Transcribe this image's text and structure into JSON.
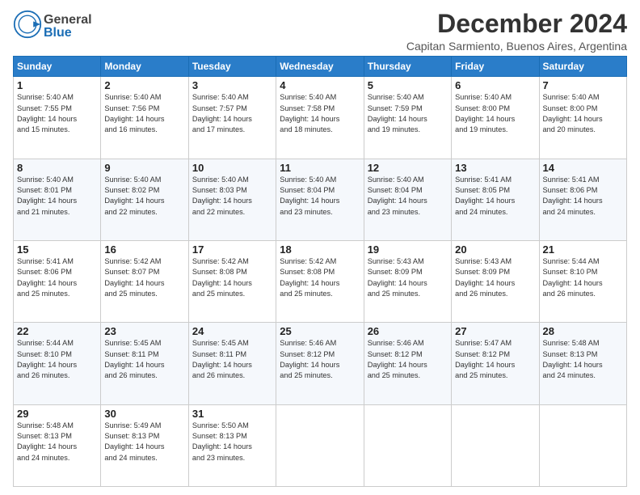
{
  "header": {
    "title": "December 2024",
    "subtitle": "Capitan Sarmiento, Buenos Aires, Argentina",
    "logo_general": "General",
    "logo_blue": "Blue"
  },
  "days_of_week": [
    "Sunday",
    "Monday",
    "Tuesday",
    "Wednesday",
    "Thursday",
    "Friday",
    "Saturday"
  ],
  "weeks": [
    [
      {
        "num": "1",
        "sunrise": "5:40 AM",
        "sunset": "7:55 PM",
        "daylight": "14 hours and 15 minutes."
      },
      {
        "num": "2",
        "sunrise": "5:40 AM",
        "sunset": "7:56 PM",
        "daylight": "14 hours and 16 minutes."
      },
      {
        "num": "3",
        "sunrise": "5:40 AM",
        "sunset": "7:57 PM",
        "daylight": "14 hours and 17 minutes."
      },
      {
        "num": "4",
        "sunrise": "5:40 AM",
        "sunset": "7:58 PM",
        "daylight": "14 hours and 18 minutes."
      },
      {
        "num": "5",
        "sunrise": "5:40 AM",
        "sunset": "7:59 PM",
        "daylight": "14 hours and 19 minutes."
      },
      {
        "num": "6",
        "sunrise": "5:40 AM",
        "sunset": "8:00 PM",
        "daylight": "14 hours and 19 minutes."
      },
      {
        "num": "7",
        "sunrise": "5:40 AM",
        "sunset": "8:00 PM",
        "daylight": "14 hours and 20 minutes."
      }
    ],
    [
      {
        "num": "8",
        "sunrise": "5:40 AM",
        "sunset": "8:01 PM",
        "daylight": "14 hours and 21 minutes."
      },
      {
        "num": "9",
        "sunrise": "5:40 AM",
        "sunset": "8:02 PM",
        "daylight": "14 hours and 22 minutes."
      },
      {
        "num": "10",
        "sunrise": "5:40 AM",
        "sunset": "8:03 PM",
        "daylight": "14 hours and 22 minutes."
      },
      {
        "num": "11",
        "sunrise": "5:40 AM",
        "sunset": "8:04 PM",
        "daylight": "14 hours and 23 minutes."
      },
      {
        "num": "12",
        "sunrise": "5:40 AM",
        "sunset": "8:04 PM",
        "daylight": "14 hours and 23 minutes."
      },
      {
        "num": "13",
        "sunrise": "5:41 AM",
        "sunset": "8:05 PM",
        "daylight": "14 hours and 24 minutes."
      },
      {
        "num": "14",
        "sunrise": "5:41 AM",
        "sunset": "8:06 PM",
        "daylight": "14 hours and 24 minutes."
      }
    ],
    [
      {
        "num": "15",
        "sunrise": "5:41 AM",
        "sunset": "8:06 PM",
        "daylight": "14 hours and 25 minutes."
      },
      {
        "num": "16",
        "sunrise": "5:42 AM",
        "sunset": "8:07 PM",
        "daylight": "14 hours and 25 minutes."
      },
      {
        "num": "17",
        "sunrise": "5:42 AM",
        "sunset": "8:08 PM",
        "daylight": "14 hours and 25 minutes."
      },
      {
        "num": "18",
        "sunrise": "5:42 AM",
        "sunset": "8:08 PM",
        "daylight": "14 hours and 25 minutes."
      },
      {
        "num": "19",
        "sunrise": "5:43 AM",
        "sunset": "8:09 PM",
        "daylight": "14 hours and 25 minutes."
      },
      {
        "num": "20",
        "sunrise": "5:43 AM",
        "sunset": "8:09 PM",
        "daylight": "14 hours and 26 minutes."
      },
      {
        "num": "21",
        "sunrise": "5:44 AM",
        "sunset": "8:10 PM",
        "daylight": "14 hours and 26 minutes."
      }
    ],
    [
      {
        "num": "22",
        "sunrise": "5:44 AM",
        "sunset": "8:10 PM",
        "daylight": "14 hours and 26 minutes."
      },
      {
        "num": "23",
        "sunrise": "5:45 AM",
        "sunset": "8:11 PM",
        "daylight": "14 hours and 26 minutes."
      },
      {
        "num": "24",
        "sunrise": "5:45 AM",
        "sunset": "8:11 PM",
        "daylight": "14 hours and 26 minutes."
      },
      {
        "num": "25",
        "sunrise": "5:46 AM",
        "sunset": "8:12 PM",
        "daylight": "14 hours and 25 minutes."
      },
      {
        "num": "26",
        "sunrise": "5:46 AM",
        "sunset": "8:12 PM",
        "daylight": "14 hours and 25 minutes."
      },
      {
        "num": "27",
        "sunrise": "5:47 AM",
        "sunset": "8:12 PM",
        "daylight": "14 hours and 25 minutes."
      },
      {
        "num": "28",
        "sunrise": "5:48 AM",
        "sunset": "8:13 PM",
        "daylight": "14 hours and 24 minutes."
      }
    ],
    [
      {
        "num": "29",
        "sunrise": "5:48 AM",
        "sunset": "8:13 PM",
        "daylight": "14 hours and 24 minutes."
      },
      {
        "num": "30",
        "sunrise": "5:49 AM",
        "sunset": "8:13 PM",
        "daylight": "14 hours and 24 minutes."
      },
      {
        "num": "31",
        "sunrise": "5:50 AM",
        "sunset": "8:13 PM",
        "daylight": "14 hours and 23 minutes."
      },
      null,
      null,
      null,
      null
    ]
  ],
  "labels": {
    "sunrise": "Sunrise:",
    "sunset": "Sunset:",
    "daylight": "Daylight:"
  }
}
